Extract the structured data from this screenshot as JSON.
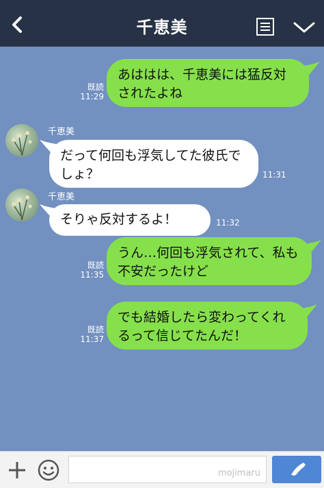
{
  "header": {
    "title": "千恵美",
    "back_icon": "chevron-left-icon",
    "memo_icon": "note-icon",
    "menu_icon": "chevron-down-icon"
  },
  "messages": [
    {
      "side": "me",
      "read": "既読",
      "time": "11:29",
      "text": "あははは、千恵美には猛反対されたよね"
    },
    {
      "side": "them",
      "name": "千恵美",
      "time": "11:31",
      "text": "だって何回も浮気してた彼氏でしょ？"
    },
    {
      "side": "them",
      "name": "千恵美",
      "time": "11:32",
      "text": "そりゃ反対するよ！"
    },
    {
      "side": "me",
      "read": "既読",
      "time": "11:35",
      "text": "うん…何回も浮気されて、私も不安だったけど"
    },
    {
      "side": "me",
      "read": "既読",
      "time": "11:37",
      "text": "でも結婚したら変わってくれるって信じてたんだ！"
    }
  ],
  "footer": {
    "plus_icon": "plus-icon",
    "emoji_icon": "smile-icon",
    "input_placeholder": "",
    "watermark": "mojimaru",
    "call_icon": "phone-icon"
  },
  "colors": {
    "header_bg": "#273246",
    "chat_bg": "#7290c0",
    "my_bubble": "#86e04b",
    "their_bubble": "#ffffff",
    "call_button": "#4f86d6"
  }
}
